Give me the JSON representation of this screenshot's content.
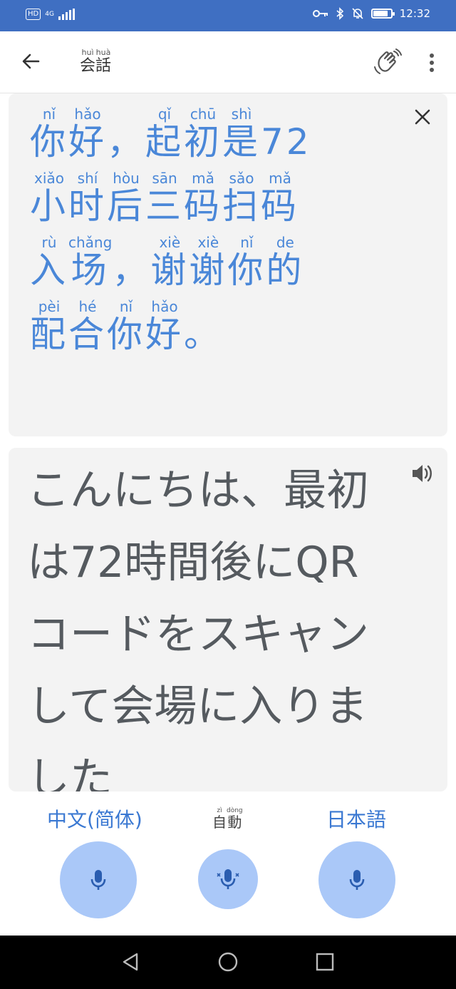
{
  "status_bar": {
    "hd": "HD",
    "network": "4G",
    "time": "12:32",
    "battery_level": 0.85,
    "icons": [
      "key-icon",
      "bluetooth-icon",
      "mute-bell-icon",
      "battery-icon"
    ]
  },
  "app_bar": {
    "title_chars": [
      "会",
      "話"
    ],
    "title_ruby": [
      "huì",
      "huà"
    ],
    "back_icon": "arrow-back-icon",
    "wave_icon": "waving-hand-icon",
    "menu_icon": "more-vert-icon"
  },
  "chinese_card": {
    "lines": [
      [
        {
          "c": "你",
          "p": "nǐ"
        },
        {
          "c": "好",
          "p": "hǎo"
        },
        {
          "c": "，",
          "p": ""
        },
        {
          "c": "起",
          "p": "qǐ"
        },
        {
          "c": "初",
          "p": "chū"
        },
        {
          "c": "是",
          "p": "shì"
        },
        {
          "c": "72",
          "p": ""
        }
      ],
      [
        {
          "c": "小",
          "p": "xiǎo"
        },
        {
          "c": "时",
          "p": "shí"
        },
        {
          "c": "后",
          "p": "hòu"
        },
        {
          "c": "三",
          "p": "sān"
        },
        {
          "c": "码",
          "p": "mǎ"
        },
        {
          "c": "扫",
          "p": "sǎo"
        },
        {
          "c": "码",
          "p": "mǎ"
        }
      ],
      [
        {
          "c": "入",
          "p": "rù"
        },
        {
          "c": "场",
          "p": "chǎng"
        },
        {
          "c": "，",
          "p": ""
        },
        {
          "c": "谢",
          "p": "xiè"
        },
        {
          "c": "谢",
          "p": "xiè"
        },
        {
          "c": "你",
          "p": "nǐ"
        },
        {
          "c": "的",
          "p": "de"
        }
      ],
      [
        {
          "c": "配",
          "p": "pèi"
        },
        {
          "c": "合",
          "p": "hé"
        },
        {
          "c": "你",
          "p": "nǐ"
        },
        {
          "c": "好",
          "p": "hǎo"
        },
        {
          "c": "。",
          "p": ""
        }
      ]
    ],
    "close_icon": "close-icon",
    "text_color": "#4a87d8"
  },
  "japanese_card": {
    "text": "こんにちは、最初は72時間後にQRコードをスキャンして会場に入りました",
    "speaker_icon": "speaker-icon",
    "text_color": "#555a5f"
  },
  "bottom": {
    "left_lang": "中文(简体)",
    "auto_chars": [
      "自",
      "動"
    ],
    "auto_ruby": [
      "zì",
      "dòng"
    ],
    "right_lang": "日本語",
    "mic_icon": "microphone-icon",
    "auto_mic_icon": "auto-microphone-icon",
    "accent": "#3a78d2",
    "mic_bg": "#aac8f8"
  },
  "nav_bar": {
    "icons": [
      "nav-back-icon",
      "nav-home-icon",
      "nav-recents-icon"
    ]
  }
}
